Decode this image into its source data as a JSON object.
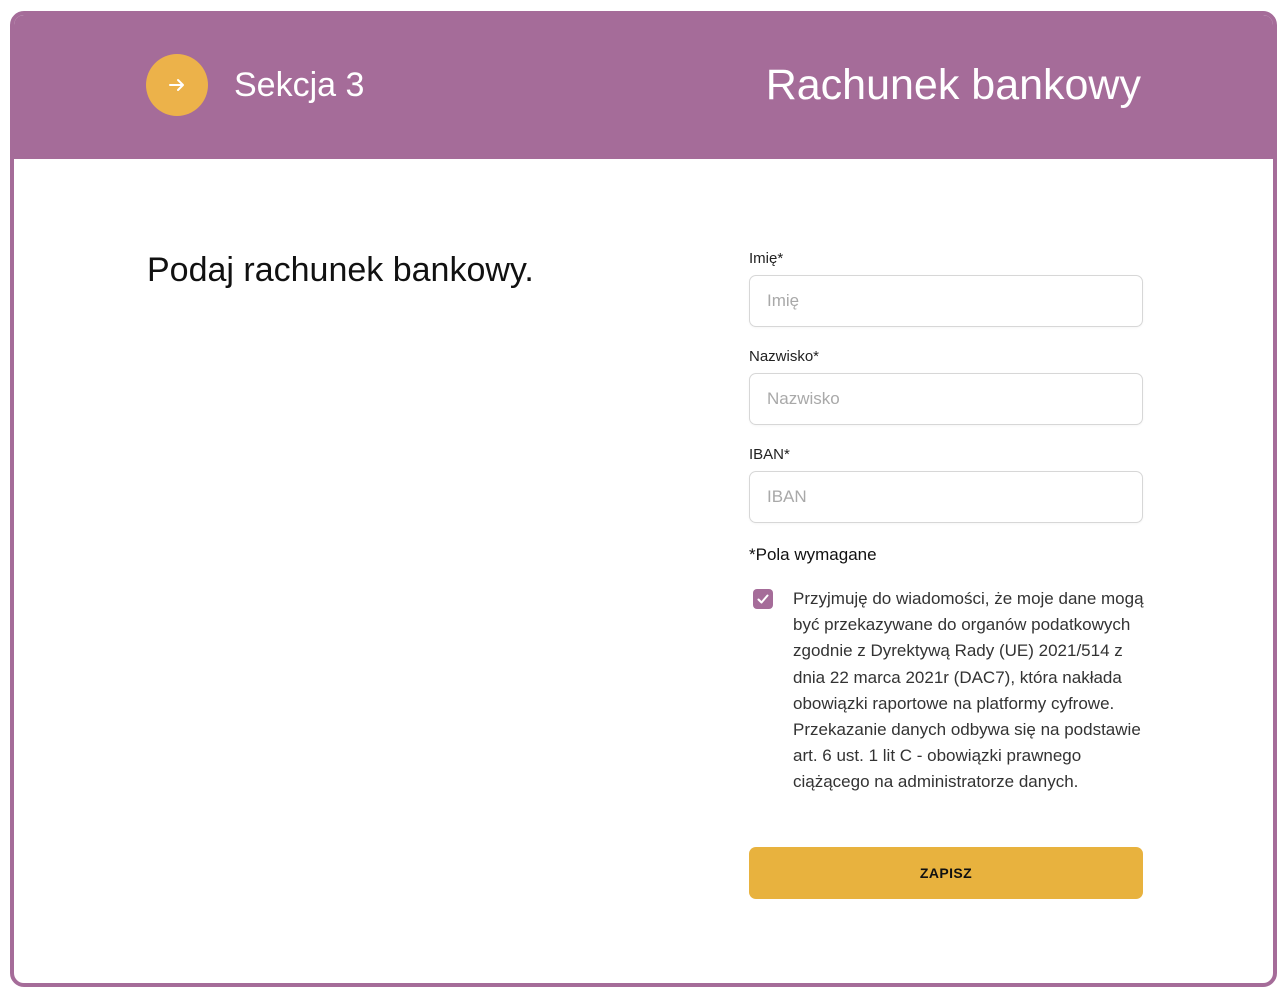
{
  "header": {
    "section_label": "Sekcja 3",
    "title": "Rachunek bankowy",
    "step_icon": "arrow-right-icon"
  },
  "intro": {
    "heading": "Podaj rachunek bankowy."
  },
  "form": {
    "first_name": {
      "label": "Imię*",
      "placeholder": "Imię",
      "value": ""
    },
    "last_name": {
      "label": "Nazwisko*",
      "placeholder": "Nazwisko",
      "value": ""
    },
    "iban": {
      "label": "IBAN*",
      "placeholder": "IBAN",
      "value": ""
    },
    "required_note": "*Pola wymagane",
    "consent": {
      "checked": true,
      "text": "Przyjmuję do wiadomości, że moje dane mogą być przekazywane do organów podatkowych zgodnie z Dyrektywą Rady (UE) 2021/514 z dnia 22 marca 2021r (DAC7), która nakłada obowiązki raportowe na platformy cyfrowe. Przekazanie danych odbywa się na podstawie art. 6 ust. 1 lit C - obowiązki prawnego ciążącego na administratorze danych."
    },
    "save_label": "ZAPISZ"
  },
  "colors": {
    "header_purple": "#a56c99",
    "accent_yellow": "#e8b23e",
    "step_circle_orange": "#ecb24a"
  }
}
